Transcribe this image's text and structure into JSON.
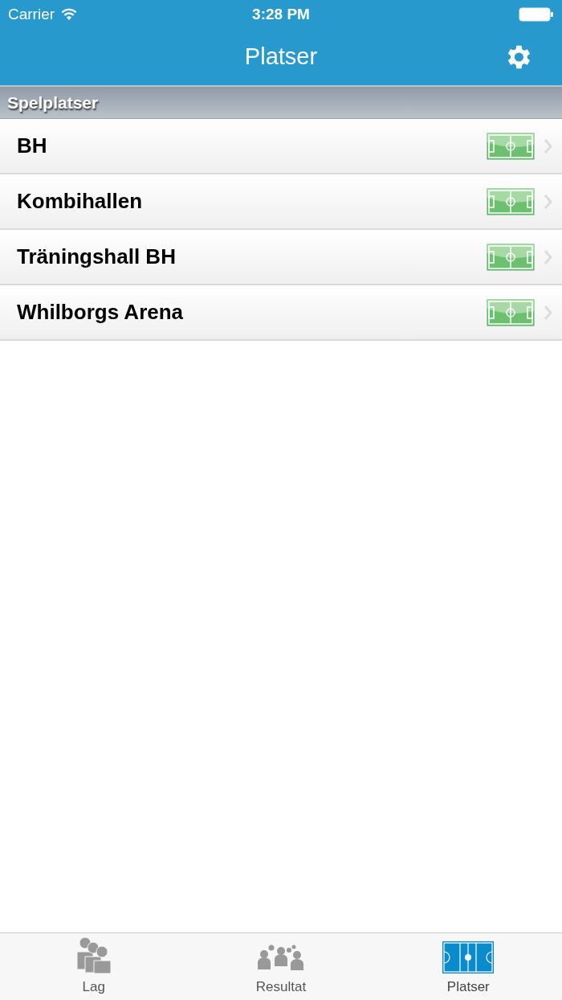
{
  "status_bar": {
    "carrier": "Carrier",
    "time": "3:28 PM"
  },
  "nav_bar": {
    "title": "Platser"
  },
  "section": {
    "title": "Spelplatser"
  },
  "rows": [
    {
      "label": "BH"
    },
    {
      "label": "Kombihallen"
    },
    {
      "label": "Träningshall BH"
    },
    {
      "label": "Whilborgs Arena"
    }
  ],
  "tabs": [
    {
      "kind": "team",
      "label": "Lag",
      "selected": false
    },
    {
      "kind": "results",
      "label": "Resultat",
      "selected": false
    },
    {
      "kind": "venues",
      "label": "Platser",
      "selected": true
    }
  ]
}
